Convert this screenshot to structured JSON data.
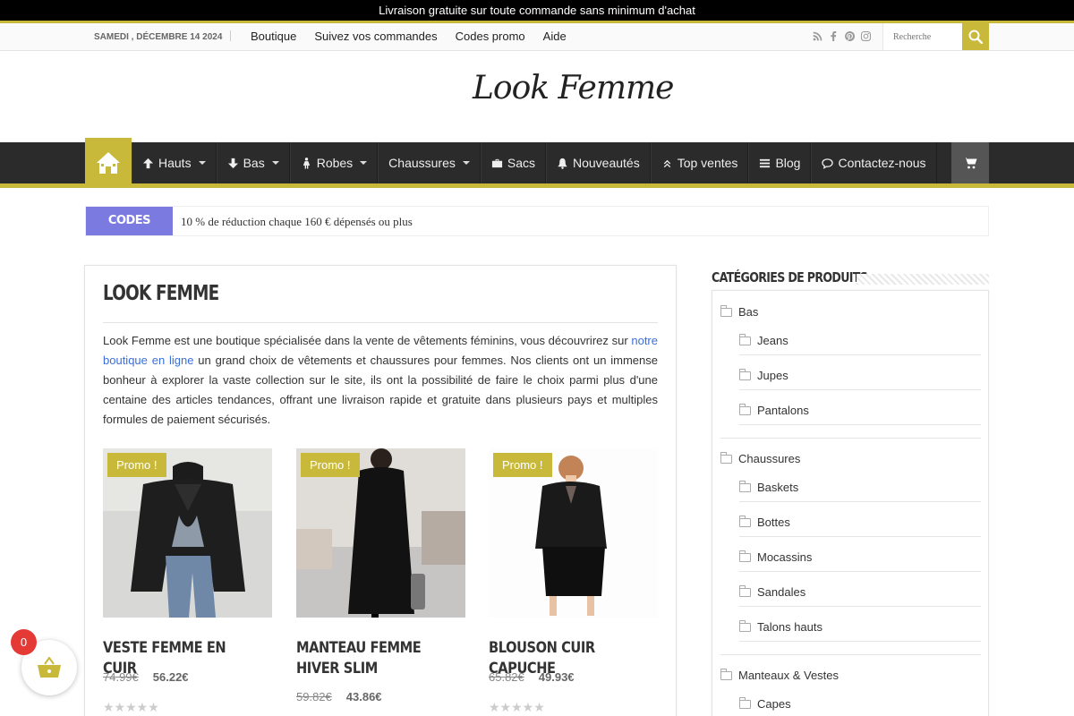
{
  "promo_bar": "Livraison gratuite sur toute commande sans minimum d'achat",
  "topnav": {
    "date": "SAMEDI , DÉCEMBRE 14 2024",
    "links": [
      "Boutique",
      "Suivez vos commandes",
      "Codes promo",
      "Aide"
    ],
    "social_icons": [
      "rss-icon",
      "facebook-icon",
      "pinterest-icon",
      "instagram-icon"
    ],
    "search_placeholder": "Recherche"
  },
  "logo": "Look Femme",
  "mainnav": {
    "items": [
      {
        "label": "Hauts",
        "icon": "arrow-up-icon",
        "dropdown": true
      },
      {
        "label": "Bas",
        "icon": "arrow-down-icon",
        "dropdown": true
      },
      {
        "label": "Robes",
        "icon": "female-icon",
        "dropdown": true
      },
      {
        "label": "Chaussures",
        "icon": "",
        "dropdown": true
      },
      {
        "label": "Sacs",
        "icon": "briefcase-icon",
        "dropdown": false
      },
      {
        "label": "Nouveautés",
        "icon": "bell-icon",
        "dropdown": false
      },
      {
        "label": "Top ventes",
        "icon": "double-chevron-up-icon",
        "dropdown": false
      },
      {
        "label": "Blog",
        "icon": "list-icon",
        "dropdown": false
      },
      {
        "label": "Contactez-nous",
        "icon": "comment-icon",
        "dropdown": false
      }
    ]
  },
  "ticker": {
    "label": "CODES PROMO",
    "text": "10 % de réduction chaque 160 € dépensés ou plus"
  },
  "content": {
    "title": "LOOK FEMME",
    "intro_before": "Look Femme est une boutique spécialisée dans la vente de vêtements féminins, vous découvrirez sur ",
    "intro_link": "notre boutique en ligne",
    "intro_after": " un grand choix de vêtements et chaussures pour femmes. Nos clients ont un immense bonheur à explorer la vaste collection sur le site, ils ont la possibilité de faire le  choix parmi plus d'une centaine des articles tendances, offrant une livraison rapide et gratuite dans plusieurs pays et multiples formules de paiement sécurisés."
  },
  "products": [
    {
      "tag": "Promo !",
      "name": "VESTE FEMME EN CUIR",
      "old_price": "74.99€",
      "price": "56.22€"
    },
    {
      "tag": "Promo !",
      "name": "MANTEAU FEMME HIVER SLIM",
      "old_price": "59.82€",
      "price": "43.86€"
    },
    {
      "tag": "Promo !",
      "name": "BLOUSON CUIR CAPUCHE",
      "old_price": "65.82€",
      "price": "49.93€"
    }
  ],
  "sidebar": {
    "heading": "CATÉGORIES DE PRODUITS",
    "categories": [
      {
        "label": "Bas",
        "children": [
          "Jeans",
          "Jupes",
          "Pantalons"
        ]
      },
      {
        "label": "Chaussures",
        "children": [
          "Baskets",
          "Bottes",
          "Mocassins",
          "Sandales",
          "Talons hauts"
        ]
      },
      {
        "label": "Manteaux & Vestes",
        "children": [
          "Capes"
        ]
      }
    ]
  },
  "cart": {
    "count": "0"
  },
  "colors": {
    "accent": "#c9b93b",
    "nav": "#2b2b2b",
    "ticker": "#7a7ae0",
    "badge": "#e53935"
  }
}
